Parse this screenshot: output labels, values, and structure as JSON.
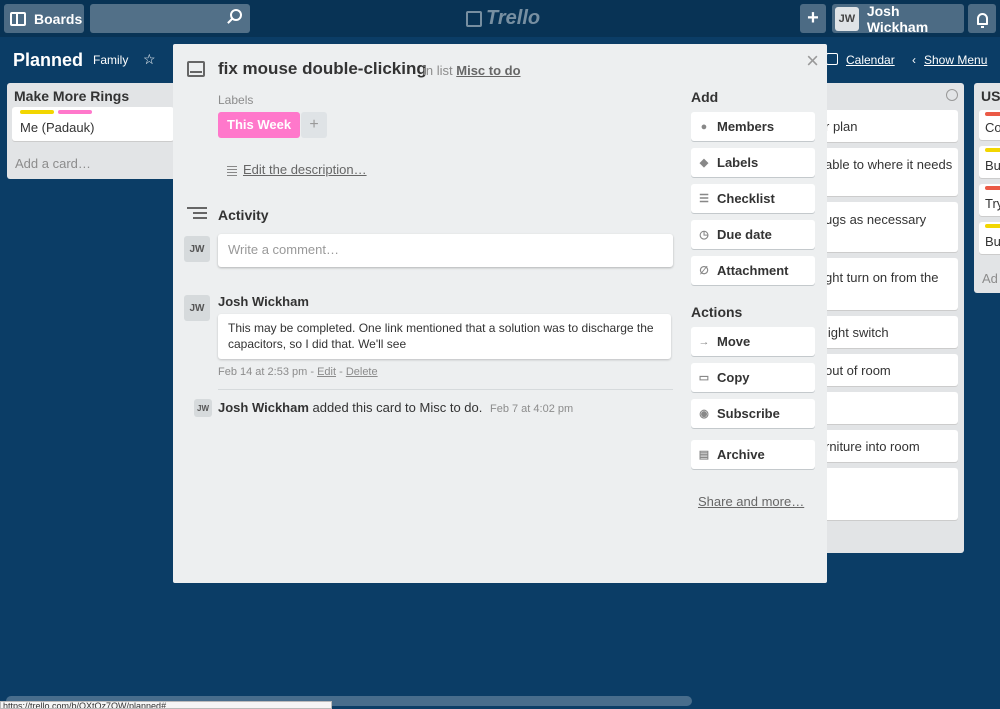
{
  "header": {
    "boards_label": "Boards",
    "logo_text": "Trello",
    "plus_label": "+",
    "user_initials": "JW",
    "user_name": "Josh Wickham"
  },
  "board": {
    "title": "Planned",
    "team": "Family",
    "calendar_label": "Calendar",
    "menu_label": "Show Menu"
  },
  "lists": {
    "left": {
      "title": "Make More Rings",
      "card_text": "Me (Padauk)",
      "add_card": "Add a card…"
    },
    "right_cards": [
      "r plan",
      "able to where it needs",
      "ugs as necessary",
      "ght turn on from the",
      "light switch",
      "out of room",
      "rniture into room"
    ],
    "far_right": {
      "title": "US",
      "cards": [
        "Co",
        "Bu",
        "Try",
        "Bu"
      ],
      "add": "Ad"
    }
  },
  "modal": {
    "title": "fix mouse double-clicking",
    "in_list_prefix": "in list",
    "list_name": "Misc to do",
    "labels_heading": "Labels",
    "label_chip": "This Week",
    "label_add": "+",
    "edit_description": "Edit the description…",
    "activity_heading": "Activity",
    "comment_placeholder": "Write a comment…",
    "avatar_initials": "JW",
    "comment": {
      "author": "Josh Wickham",
      "body": "This may be completed. One link mentioned that a solution was to discharge the capacitors, so I did that. We'll see",
      "time": "Feb 14 at 2:53 pm",
      "sep1": " - ",
      "edit": "Edit",
      "sep2": " - ",
      "delete": "Delete"
    },
    "added": {
      "author": "Josh Wickham",
      "text": "added this card to Misc to do.",
      "time": "Feb 7 at 4:02 pm"
    },
    "add_heading": "Add",
    "add_buttons": [
      "Members",
      "Labels",
      "Checklist",
      "Due date",
      "Attachment"
    ],
    "actions_heading": "Actions",
    "action_buttons": [
      "Move",
      "Copy",
      "Subscribe",
      "Archive"
    ],
    "share_link": "Share and more…",
    "close": "×"
  },
  "status_url": "https://trello.com/b/QXtOz7OW/planned#",
  "colors": {
    "background": "#0b3d66",
    "label_pink": "#ff78cb",
    "label_yellow": "#f2d600",
    "label_red": "#eb5a46"
  }
}
